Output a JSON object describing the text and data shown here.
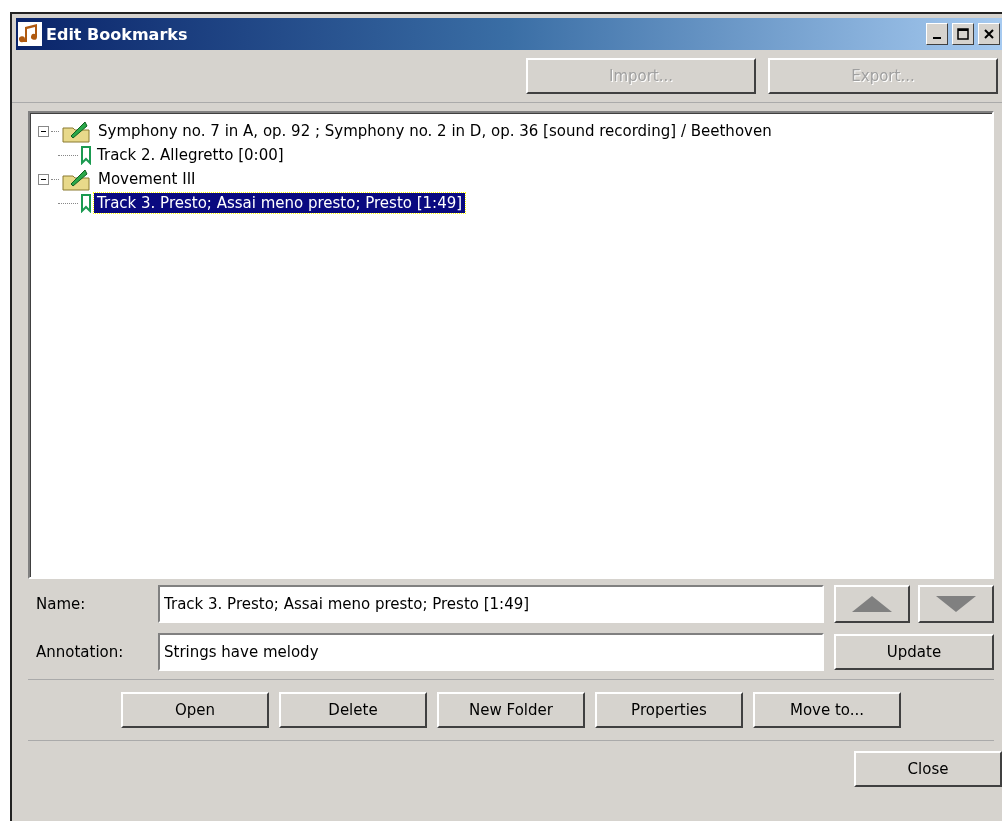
{
  "window": {
    "title": "Edit Bookmarks"
  },
  "toolbar": [
    {
      "label": "Import...",
      "disabled": true
    },
    {
      "label": "Export...",
      "disabled": true
    }
  ],
  "tree": [
    {
      "kind": "folder",
      "label": "Symphony no. 7 in A, op. 92 ; Symphony no. 2 in D, op. 36 [sound recording] / Beethoven",
      "expanded": true,
      "selected": false,
      "children": [
        {
          "kind": "bookmark",
          "label": "Track 2. Allegretto [0:00]",
          "selected": false
        }
      ]
    },
    {
      "kind": "folder",
      "label": "Movement III",
      "expanded": true,
      "selected": false,
      "children": [
        {
          "kind": "bookmark",
          "label": "Track 3. Presto; Assai meno presto; Presto [1:49]",
          "selected": true
        }
      ]
    }
  ],
  "form": {
    "name_label": "Name:",
    "name_value": "Track 3. Presto; Assai meno presto; Presto [1:49]",
    "annotation_label": "Annotation:",
    "annotation_value": "Strings have melody",
    "update": "Update"
  },
  "actions": [
    "Open",
    "Delete",
    "New Folder",
    "Properties",
    "Move to..."
  ],
  "close": "Close"
}
